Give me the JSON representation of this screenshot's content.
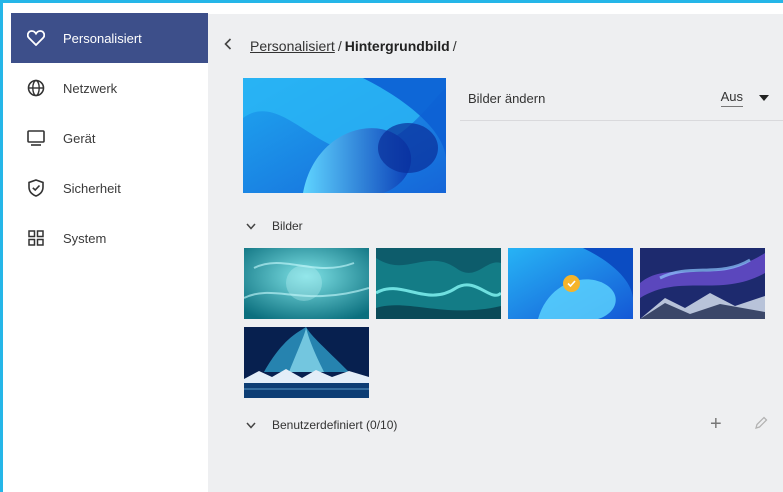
{
  "sidebar": {
    "items": [
      {
        "label": "Personalisiert",
        "icon": "heart-icon",
        "active": true
      },
      {
        "label": "Netzwerk",
        "icon": "globe-icon",
        "active": false
      },
      {
        "label": "Gerät",
        "icon": "monitor-icon",
        "active": false
      },
      {
        "label": "Sicherheit",
        "icon": "shield-check-icon",
        "active": false
      },
      {
        "label": "System",
        "icon": "grid-icon",
        "active": false
      }
    ]
  },
  "breadcrumb": {
    "back_icon": "chevron-left-icon",
    "parent": "Personalisiert",
    "separator": "/",
    "current": "Hintergrundbild",
    "trailing_separator": "/"
  },
  "setting": {
    "label": "Bilder ändern",
    "value": "Aus",
    "dropdown_icon": "triangle-down-icon"
  },
  "sections": {
    "images": {
      "label": "Bilder",
      "icon": "chevron-down-icon"
    },
    "custom": {
      "label": "Benutzerdefiniert (0/10)",
      "icon": "chevron-down-icon"
    }
  },
  "thumbnails": [
    {
      "name": "teal-ice",
      "selected": false
    },
    {
      "name": "teal-marble",
      "selected": false
    },
    {
      "name": "blue-wave",
      "selected": true
    },
    {
      "name": "aurora-mountains",
      "selected": false
    },
    {
      "name": "aurora-lake",
      "selected": false
    }
  ],
  "actions": {
    "add_icon": "plus-icon",
    "edit_icon": "pencil-icon",
    "add_glyph": "+"
  },
  "colors": {
    "accent_border": "#25b6e8",
    "active_nav": "#3d4f8a",
    "panel_bg": "#eeeff1",
    "check": "#f5b42a"
  }
}
